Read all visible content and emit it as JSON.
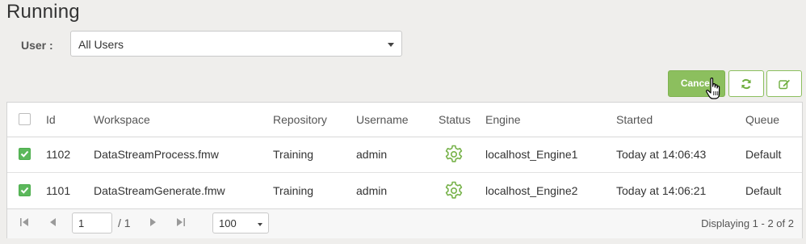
{
  "page": {
    "title": "Running"
  },
  "filter": {
    "user_label": "User :",
    "user_value": "All Users"
  },
  "toolbar": {
    "cancel_label": "Cancel",
    "refresh_icon": "refresh-icon",
    "edit_icon": "edit-icon"
  },
  "table": {
    "headers": [
      "Id",
      "Workspace",
      "Repository",
      "Username",
      "Status",
      "Engine",
      "Started",
      "Queue"
    ],
    "rows": [
      {
        "checked": true,
        "id": "1102",
        "workspace": "DataStreamProcess.fmw",
        "repository": "Training",
        "username": "admin",
        "status_icon": "gear-icon",
        "engine": "localhost_Engine1",
        "started": "Today at 14:06:43",
        "queue": "Default"
      },
      {
        "checked": true,
        "id": "1101",
        "workspace": "DataStreamGenerate.fmw",
        "repository": "Training",
        "username": "admin",
        "status_icon": "gear-icon",
        "engine": "localhost_Engine2",
        "started": "Today at 14:06:21",
        "queue": "Default"
      }
    ]
  },
  "pager": {
    "page": "1",
    "of_total": "/ 1",
    "page_size": "100",
    "display": "Displaying 1 - 2 of 2"
  },
  "colors": {
    "accent": "#8cbf5e",
    "check": "#5cb85c",
    "background": "#efeeec"
  }
}
